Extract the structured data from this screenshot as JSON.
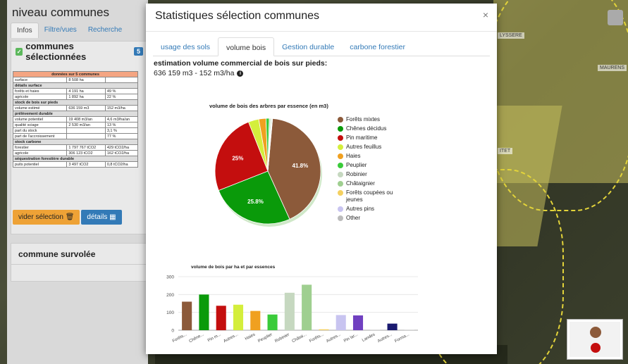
{
  "map": {
    "labels": [
      "LYSSERE",
      "MAURENS",
      "ITET"
    ]
  },
  "left_panel": {
    "title": "niveau communes",
    "tabs": [
      "Infos",
      "Filtre/vues",
      "Recherche"
    ],
    "box_title": "communes sélectionnées",
    "box_count": "5",
    "table": {
      "header": "données sur 5 communes",
      "rows": [
        {
          "type": "row",
          "cells": [
            "surface",
            "8 508 ha",
            ""
          ]
        },
        {
          "type": "sec",
          "cells": [
            "détails surface"
          ]
        },
        {
          "type": "row",
          "cells": [
            "forêts et haies",
            "4 191 ha",
            "49 %"
          ]
        },
        {
          "type": "row",
          "cells": [
            "agricole",
            "1 892 ha",
            "22 %"
          ]
        },
        {
          "type": "sec",
          "cells": [
            "stock de bois sur pieds"
          ]
        },
        {
          "type": "row",
          "cells": [
            "volume estimé",
            "636 159 m3",
            "152 m3/ha"
          ]
        },
        {
          "type": "sec",
          "cells": [
            "prélèvement durable"
          ]
        },
        {
          "type": "row",
          "cells": [
            "volume potentiel",
            "19 408 m3/an",
            "4,6 m3/ha/an"
          ]
        },
        {
          "type": "row",
          "cells": [
            "qualité sciage",
            "2 530 m3/an",
            "13 %"
          ]
        },
        {
          "type": "row",
          "cells": [
            "part du stock",
            "",
            "3,1 %"
          ]
        },
        {
          "type": "row",
          "cells": [
            "part de l'accroissement",
            "",
            "77 %"
          ]
        },
        {
          "type": "sec",
          "cells": [
            "stock carbone"
          ]
        },
        {
          "type": "row",
          "cells": [
            "forestier",
            "1 797 767 tCO2",
            "429 tCO2/ha"
          ]
        },
        {
          "type": "row",
          "cells": [
            "agricole",
            "306 123 tCO2",
            "162 tCO2/ha"
          ]
        },
        {
          "type": "sec",
          "cells": [
            "séquestration forestière durable"
          ]
        },
        {
          "type": "row",
          "cells": [
            "puits potentiel",
            "3 497 tCO2",
            "0,8 tCO2/ha"
          ]
        }
      ]
    },
    "btn_clear": "vider sélection",
    "btn_details": "détails",
    "hover_title": "commune survolée"
  },
  "modal": {
    "title": "Statistiques sélection communes",
    "close": "×",
    "tabs": [
      "usage des sols",
      "volume bois",
      "Gestion durable",
      "carbone forestier"
    ],
    "active_tab": "volume bois",
    "estimate_label": "estimation volume commercial de bois sur pieds:",
    "estimate_value": "636 159 m3 - 152 m3/ha"
  },
  "chart_data": [
    {
      "type": "pie",
      "title": "volume de bois des arbres par essence (en m3)",
      "categories": [
        "Forêts mixtes",
        "Chênes décidus",
        "Pin maritime",
        "Autres feuillus",
        "Haies",
        "Peuplier",
        "Robinier",
        "Châtaignier",
        "Forêts coupées ou jeunes",
        "Autres pins",
        "Other"
      ],
      "values": [
        41.8,
        25.8,
        25.0,
        3.2,
        2.2,
        1.0,
        0.4,
        0.3,
        0.1,
        0.1,
        0.1
      ],
      "data_labels": [
        "41.8%",
        "25.8%",
        "25%"
      ],
      "colors": [
        "#8c5a3a",
        "#0a9a0a",
        "#c40e0e",
        "#d4ee3c",
        "#f0a020",
        "#3acb3a",
        "#c6d8c0",
        "#9fcf90",
        "#f4d060",
        "#c8c4f0",
        "#bbbbbb"
      ],
      "legend_placement": "right"
    },
    {
      "type": "bar",
      "title": "volume de bois par ha et par essences",
      "categories": [
        "Forêts...",
        "Chêne...",
        "Pin m...",
        "Autres...",
        "Haies",
        "Peuplier",
        "Robinier",
        "Châtai...",
        "Forêts...",
        "Autres...",
        "Pin lar...",
        "Landes",
        "Autres...",
        "Forma..."
      ],
      "values": [
        160,
        200,
        137,
        143,
        108,
        88,
        210,
        255,
        5,
        85,
        83,
        2,
        37,
        2
      ],
      "colors": [
        "#8c5a3a",
        "#0a9a0a",
        "#c40e0e",
        "#d4ee3c",
        "#f0a020",
        "#3acb3a",
        "#c6d8c0",
        "#9fcf90",
        "#f4d060",
        "#c8c4f0",
        "#7040c0",
        "#bbbbbb",
        "#1a1a70",
        "#bbbbbb"
      ],
      "yticks": [
        0,
        100,
        200,
        300
      ],
      "ylim": [
        0,
        300
      ],
      "grid": true
    }
  ]
}
